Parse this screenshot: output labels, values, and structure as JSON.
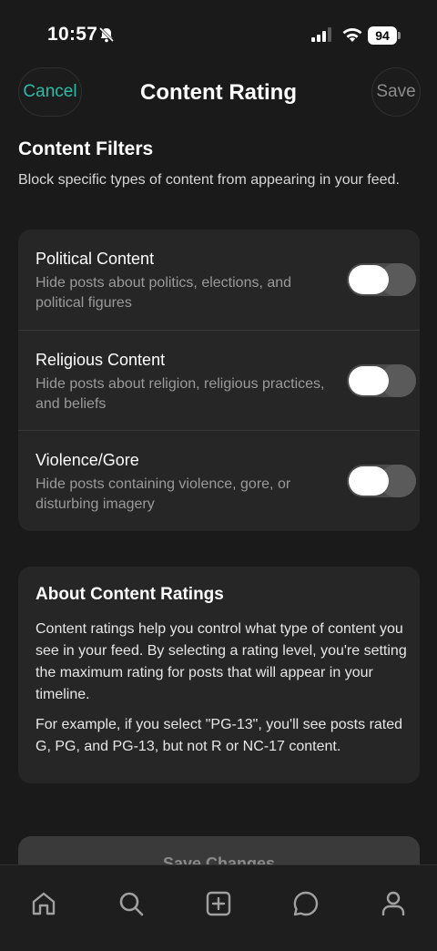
{
  "status_bar": {
    "time": "10:57",
    "battery": "94"
  },
  "header": {
    "cancel_label": "Cancel",
    "title": "Content Rating",
    "save_label": "Save"
  },
  "filters_section": {
    "title": "Content Filters",
    "description": "Block specific types of content from appearing in your feed.",
    "items": [
      {
        "title": "Political Content",
        "description": "Hide posts about politics, elections, and political figures",
        "enabled": false
      },
      {
        "title": "Religious Content",
        "description": "Hide posts about religion, religious practices, and beliefs",
        "enabled": false
      },
      {
        "title": "Violence/Gore",
        "description": "Hide posts containing violence, gore, or disturbing imagery",
        "enabled": false
      }
    ]
  },
  "about": {
    "title": "About Content Ratings",
    "paragraph1": "Content ratings help you control what type of content you see in your feed. By selecting a rating level, you're setting the maximum rating for posts that will appear in your timeline.",
    "paragraph2": "For example, if you select \"PG-13\", you'll see posts rated G, PG, and PG-13, but not R or NC-17 content."
  },
  "save_changes_label": "Save Changes",
  "tab_bar": {
    "items": [
      "home-icon",
      "search-icon",
      "create-post-icon",
      "messages-icon",
      "profile-icon"
    ]
  },
  "colors": {
    "accent": "#2bbba6",
    "background": "#1a1a1a",
    "card": "#262626"
  }
}
